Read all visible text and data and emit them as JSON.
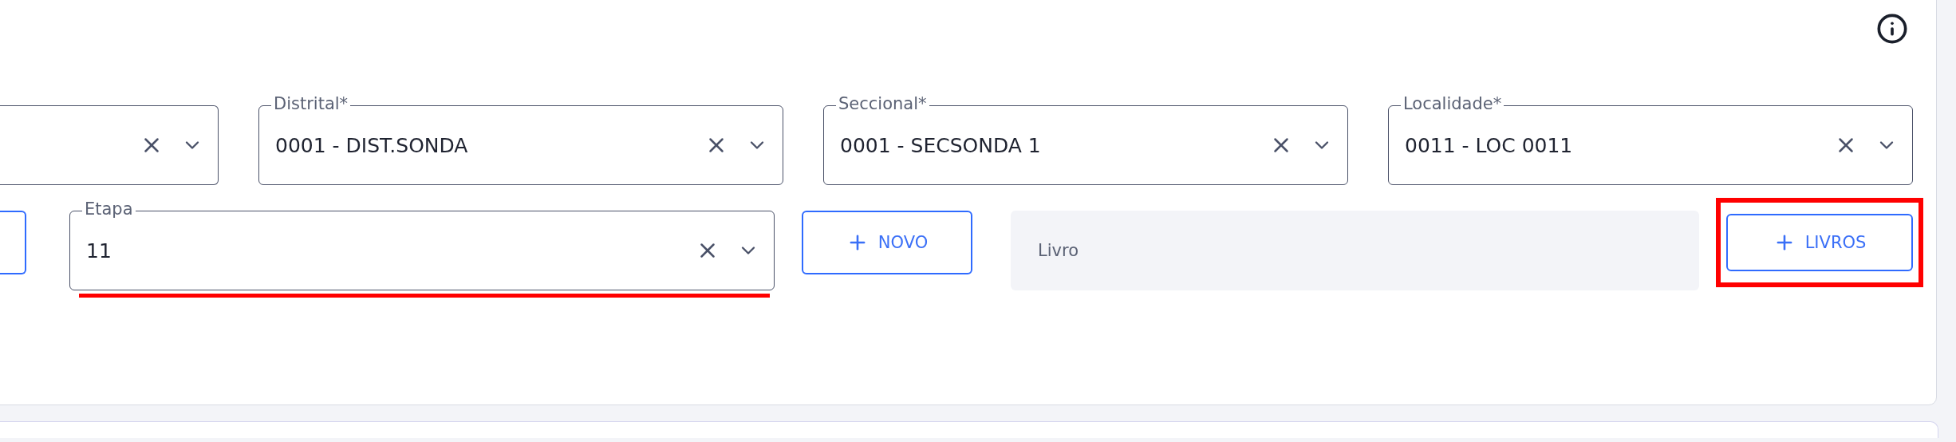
{
  "location_fields": [
    {
      "label": "Distrital*",
      "value": "0001 - DIST.SONDA"
    },
    {
      "label": "Seccional*",
      "value": "0001 - SECSONDA 1"
    },
    {
      "label": "Localidade*",
      "value": "0011 - LOC 0011"
    }
  ],
  "etapa": {
    "label": "Etapa",
    "value": "11"
  },
  "novo_button": {
    "label": "NOVO"
  },
  "livro_field": {
    "placeholder": "Livro"
  },
  "livros_button": {
    "label": "LIVROS"
  }
}
